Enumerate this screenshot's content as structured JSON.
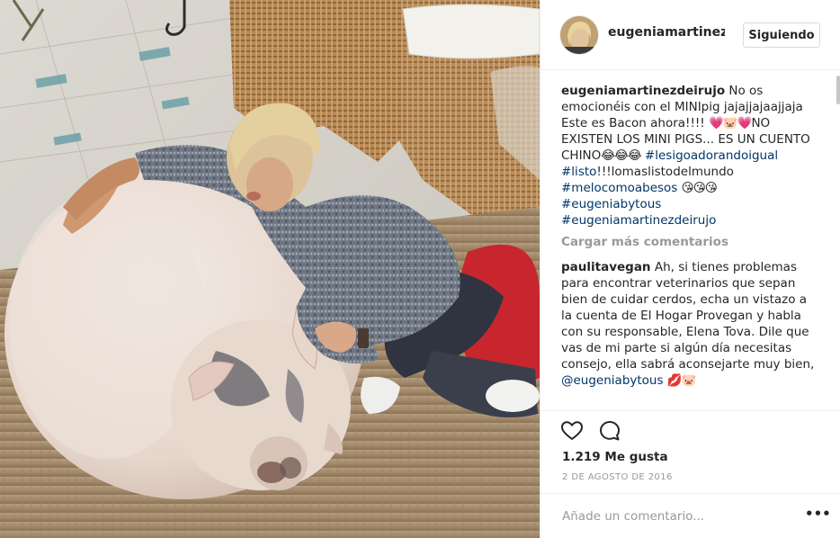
{
  "post": {
    "username": "eugeniamartinezdeirujo",
    "follow_label": "Siguiendo",
    "caption_user": "eugeniamartinezdeirujo",
    "caption_text_1": " No os emocionéis con el MINIpig jajajjajaajjaja Este es Bacon ahora!!!! ",
    "caption_emoji_1": "💗🐷💗",
    "caption_text_2": "NO EXISTEN LOS MINI PIGS... ES UN CUENTO CHINO",
    "caption_emoji_2": "😂😂😂",
    "hashtag_1": "#lesigoadorandoigual",
    "hashtag_2": "#listo",
    "caption_text_3": "!!!lomaslistodelmundo",
    "hashtag_3": "#melocomoabesos",
    "caption_emoji_3": "😘😘😘",
    "hashtag_4": "#eugeniabytous",
    "hashtag_5": "#eugeniamartinezdeirujo",
    "load_more": "Cargar más comentarios",
    "comment_user": "paulitavegan",
    "comment_text": " Ah, si tienes problemas para encontrar veterinarios que sepan bien de cuidar cerdos, echa un vistazo a la cuenta de El Hogar Provegan y habla con su responsable, Elena Tova. Dile que vas de mi parte si algún día necesitas consejo, ella sabrá aconsejarte muy bien, ",
    "comment_mention": "@eugeniabytous",
    "comment_emoji": "💋🐷",
    "likes": "1.219 Me gusta",
    "date": "2 DE AGOSTO DE 2016",
    "add_comment_placeholder": "Añade un comentario...",
    "more_label": "•••"
  },
  "icons": {
    "like": "heart-outline-icon",
    "comment": "speech-bubble-icon",
    "more": "ellipsis-icon"
  },
  "colors": {
    "hashtag": "#003569",
    "muted": "#999999",
    "text": "#262626",
    "border": "#efefef"
  }
}
